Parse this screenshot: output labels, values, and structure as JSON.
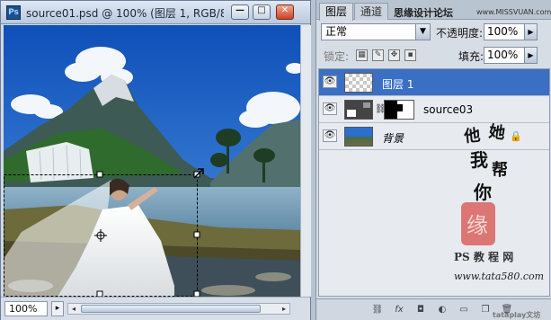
{
  "document": {
    "title": "source01.psd @ 100% (图层 1, RGB/8...",
    "app_icon_text": "Ps",
    "zoom": "100%",
    "buttons": {
      "minimize": "—",
      "maximize": "□",
      "close": "✕"
    }
  },
  "panel": {
    "tabs": [
      "图层",
      "通道"
    ],
    "header_watermark": "思缘设计论坛",
    "header_watermark_url": "www.MISSVUAN.com",
    "blend_mode": "正常",
    "opacity_label": "不透明度:",
    "opacity_value": "100%",
    "lock_label": "锁定:",
    "fill_label": "填充:",
    "fill_value": "100%",
    "layers": [
      {
        "name": "图层 1",
        "selected": true
      },
      {
        "name": "source03",
        "selected": false
      },
      {
        "name": "背景",
        "selected": false,
        "locked": true
      }
    ],
    "calligraphy_text": "他 她 我 帮 你",
    "seal_text": "缘",
    "site_name": "PS 教 程 网",
    "site_url": "www.tata580.com",
    "footer_watermark": "tataplay文坊"
  },
  "colors": {
    "selected_layer": "#3b6fc4",
    "sky": "#1f64c8"
  }
}
